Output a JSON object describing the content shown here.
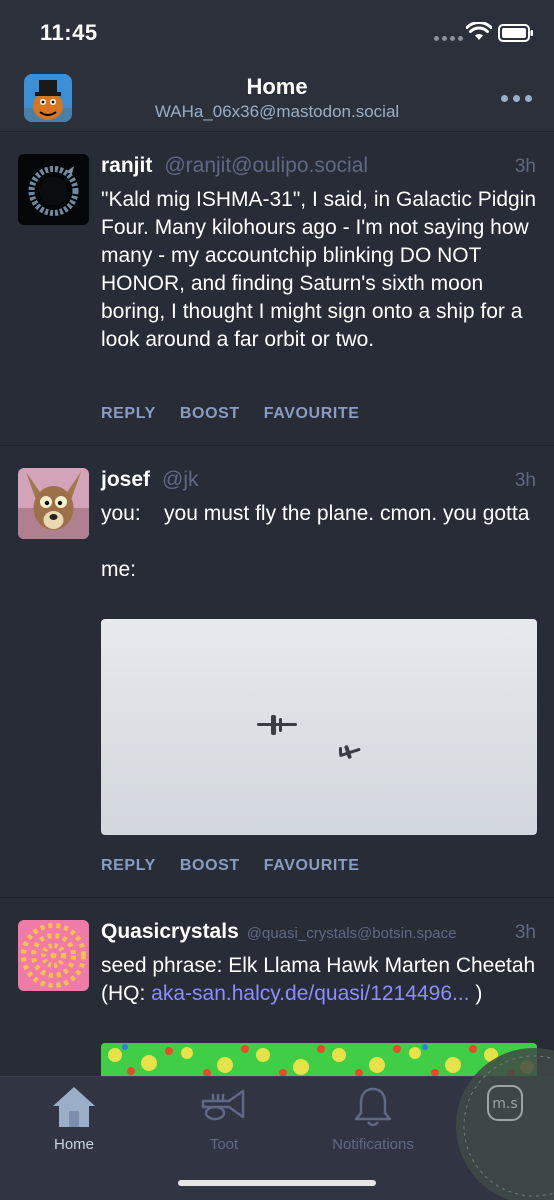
{
  "status_bar": {
    "time": "11:45"
  },
  "header": {
    "title": "Home",
    "account": "WAHa_06x36@mastodon.social"
  },
  "statuses": [
    {
      "display_name": "ranjit",
      "acct": "@ranjit@oulipo.social",
      "time": "3h",
      "content": "\"Kald mig ISHMA-31\", I said, in Galactic Pidgin Four. Many kilohours ago - I'm not saying how many - my accountchip blinking DO NOT HONOR, and finding Saturn's sixth moon boring, I thought I might sign onto a ship for a look around a far orbit or two.",
      "actions": {
        "reply": "REPLY",
        "boost": "BOOST",
        "favourite": "FAVOURITE"
      }
    },
    {
      "display_name": "josef",
      "acct": "@jk",
      "time": "3h",
      "content": "you:    you must fly the plane. cmon. you gotta\n\nme:",
      "actions": {
        "reply": "REPLY",
        "boost": "BOOST",
        "favourite": "FAVOURITE"
      }
    },
    {
      "display_name": "Quasicrystals",
      "acct": "@quasi_crystals@botsin.space",
      "time": "3h",
      "content_text": "seed phrase: Elk Llama Hawk Marten Cheetah (HQ: ",
      "content_link": "aka-san.halcy.de/quasi/1214496...",
      "content_end": " )"
    }
  ],
  "tabs": [
    {
      "label": "Home",
      "icon": "home-icon",
      "active": true
    },
    {
      "label": "Toot",
      "icon": "trumpet-icon",
      "active": false
    },
    {
      "label": "Notifications",
      "icon": "bell-icon",
      "active": false
    }
  ],
  "badge": {
    "text": "m.s"
  },
  "colors": {
    "background": "#282c37",
    "header": "#2b303b",
    "secondary_text": "#606984",
    "action_text": "#8a9dc0",
    "link": "#8c8dff",
    "tab_active": "#9baec8"
  }
}
